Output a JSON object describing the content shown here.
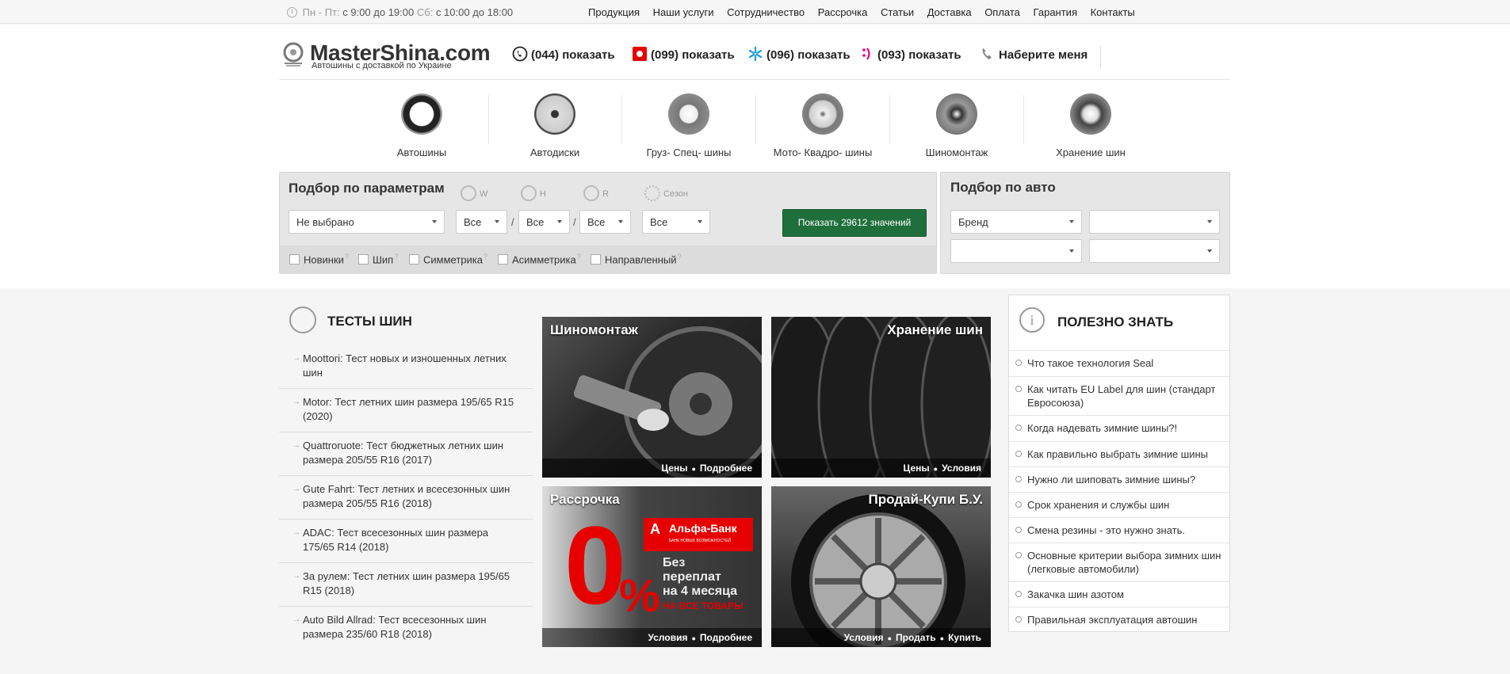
{
  "topbar": {
    "hours_weekdays_label": "Пн - Пт:",
    "hours_weekdays": "с 9:00 до 19:00",
    "hours_saturday_label": "Сб:",
    "hours_saturday": "с 10:00 до 18:00",
    "nav": [
      "Продукция",
      "Наши услуги",
      "Сотрудничество",
      "Рассрочка",
      "Статьи",
      "Доставка",
      "Оплата",
      "Гарантия",
      "Контакты"
    ]
  },
  "header": {
    "logo": "MasterShina.com",
    "tagline": "Автошины с доставкой по Украине",
    "phones": [
      {
        "code": "(044)",
        "action": "показать",
        "icon": "phone-icon"
      },
      {
        "code": "(099)",
        "action": "показать",
        "icon": "vodafone-icon"
      },
      {
        "code": "(096)",
        "action": "показать",
        "icon": "kyivstar-icon"
      },
      {
        "code": "(093)",
        "action": "показать",
        "icon": "lifecell-icon"
      }
    ],
    "callback": "Наберите меня",
    "colors": {
      "vodafone": "#e60000",
      "kyivstar": "#1e9be6",
      "lifecell": "#e6007e"
    }
  },
  "categories": [
    "Автошины",
    "Автодиски",
    "Груз- Спец- шины",
    "Мото- Квадро- шины",
    "Шиномонтаж",
    "Хранение шин"
  ],
  "filter": {
    "title": "Подбор по параметрам",
    "params": {
      "w": "W",
      "h": "H",
      "r": "R",
      "season": "Сезон"
    },
    "brand_select": "Не выбрано",
    "w_select": "Все",
    "h_select": "Все",
    "r_select": "Все",
    "season_select": "Все",
    "slash": "/",
    "button": "Показать 29612 значений",
    "checkboxes": [
      "Новинки",
      "Шип",
      "Симметрика",
      "Асимметрика",
      "Направленный"
    ],
    "hint": "?"
  },
  "auto": {
    "title": "Подбор по авто",
    "brand_select": "Бренд"
  },
  "tests": {
    "title": "ТЕСТЫ ШИН",
    "items": [
      "Moottori: Тест новых и изношенных летних шин",
      "Motor: Тест летних шин размера 195/65 R15 (2020)",
      "Quattroruote: Тест бюджетных летних шин размера 205/55 R16 (2017)",
      "Gute Fahrt: Тест летних и всесезонных шин размера 205/55 R16 (2018)",
      "ADAC: Тест всесезонных шин размера 175/65 R14 (2018)",
      "За рулем: Тест летних шин размера 195/65 R15 (2018)",
      "Auto Bild Allrad: Тест всесезонных шин размера 235/60 R18 (2018)"
    ]
  },
  "tiles": [
    {
      "title": "Шиномонтаж",
      "links": [
        "Цены",
        "Подробнее"
      ]
    },
    {
      "title": "Хранение шин",
      "links": [
        "Цены",
        "Условия"
      ]
    },
    {
      "title": "Рассрочка",
      "links": [
        "Условия",
        "Подробнее"
      ],
      "promo": {
        "big": "0",
        "pct": "%",
        "bank": "Альфа-Банк",
        "bank_sub": "БАНК НОВЫХ ВОЗМОЖНОСТЕЙ",
        "text1": "Без",
        "text2": "переплат",
        "text3": "на 4 месяца",
        "text4": "НА ВСЕ ТОВАРЫ"
      }
    },
    {
      "title": "Продай-Купи Б.У.",
      "links": [
        "Условия",
        "Продать",
        "Купить"
      ]
    }
  ],
  "useful": {
    "title": "ПОЛЕЗНО ЗНАТЬ",
    "icon_glyph": "i",
    "items": [
      "Что такое технология Seal",
      "Как читать EU Label для шин (стандарт Евросоюза)",
      "Когда надевать зимние шины?!",
      "Как правильно выбрать зимние шины",
      "Нужно ли шиповать зимние шины?",
      "Срок хранения и службы шин",
      "Смена резины - это нужно знать.",
      "Основные критерии выбора зимних шин (легковые автомобили)",
      "Закачка шин азотом",
      "Правильная эксплуатация автошин"
    ]
  }
}
